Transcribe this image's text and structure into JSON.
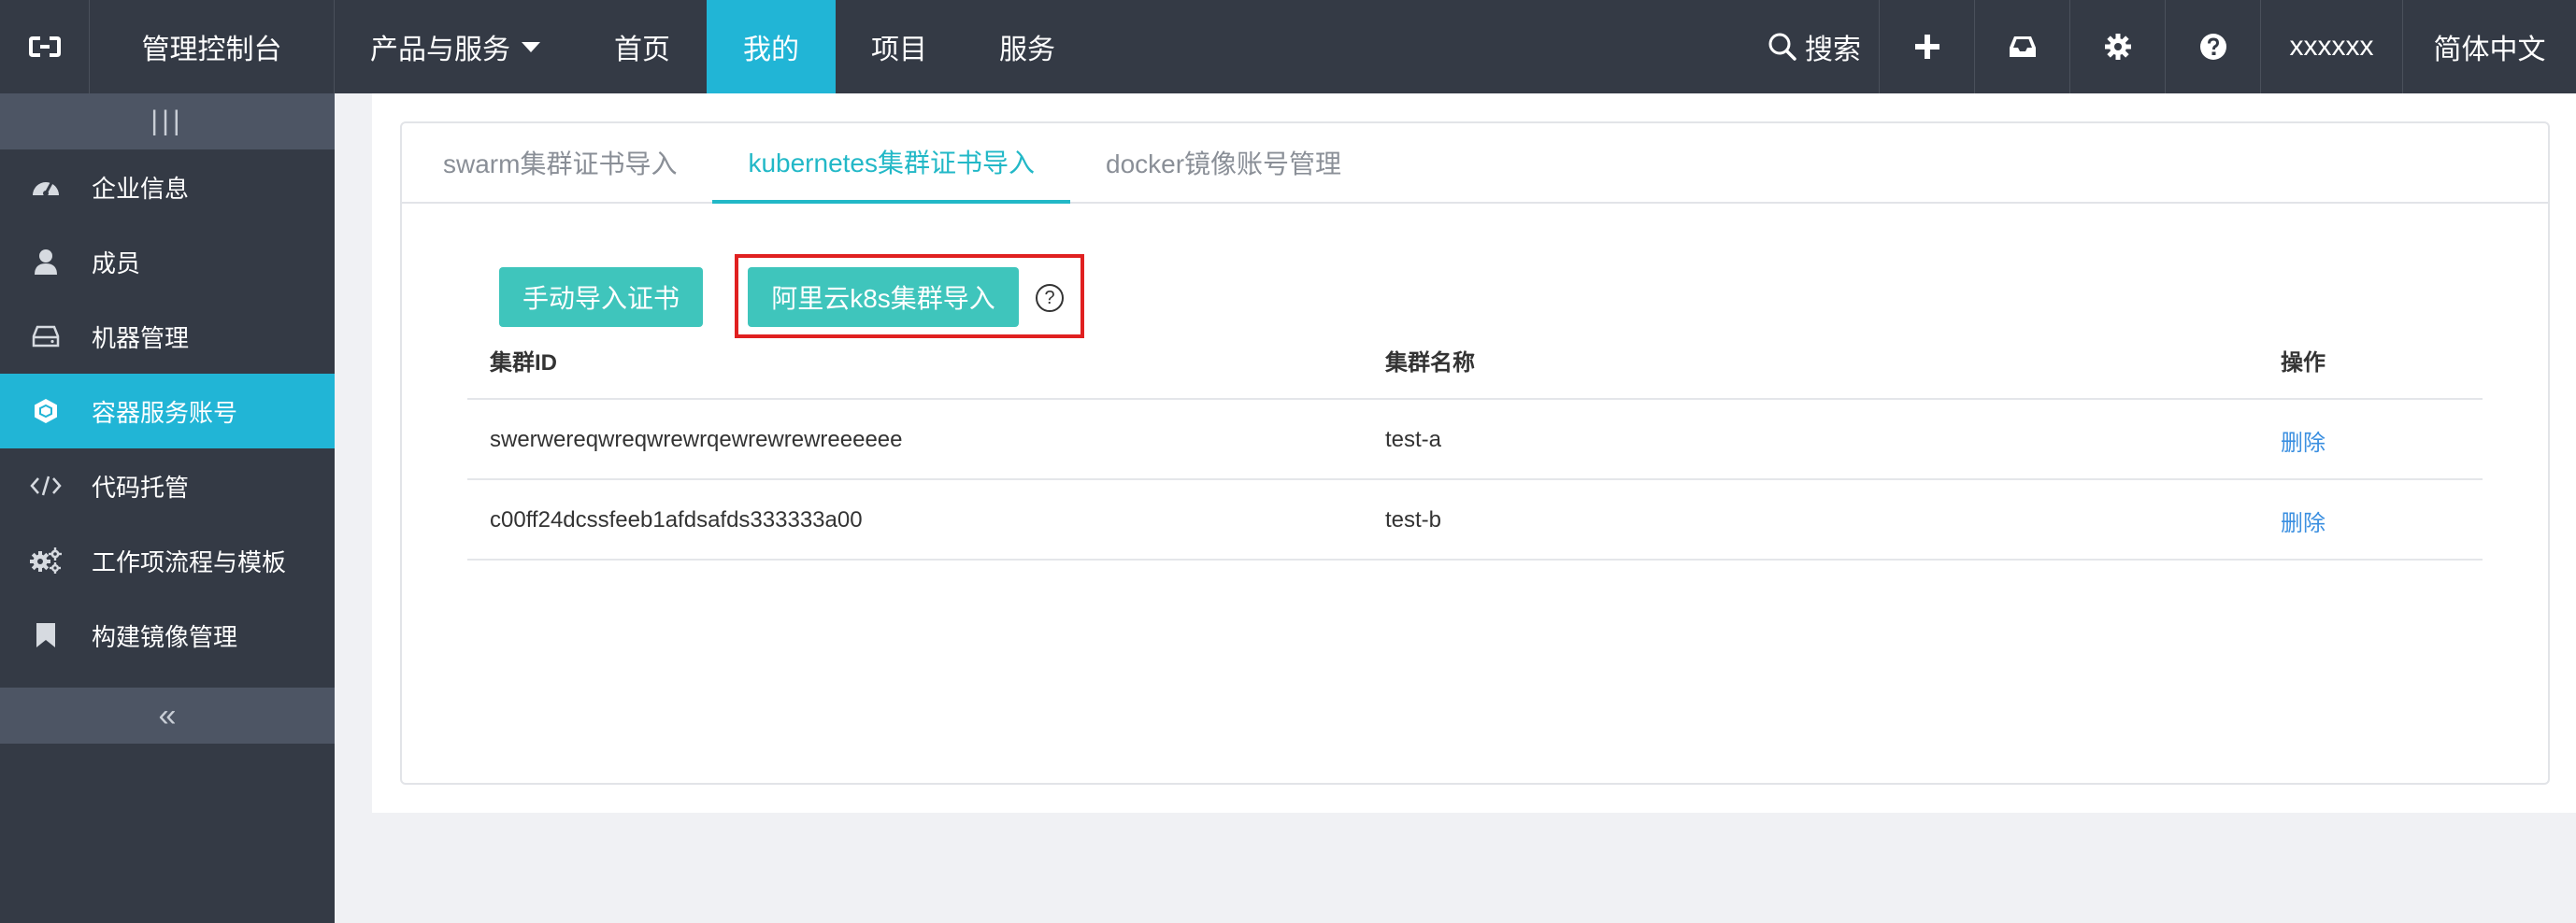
{
  "topbar": {
    "console": "管理控制台",
    "products": "产品与服务",
    "home": "首页",
    "mine": "我的",
    "project": "项目",
    "service": "服务",
    "search": "搜索",
    "user": "xxxxxx",
    "language": "简体中文"
  },
  "sidebar": {
    "toggle_label": "|||",
    "items": [
      {
        "label": "企业信息",
        "icon": "dashboard-icon"
      },
      {
        "label": "成员",
        "icon": "user-icon"
      },
      {
        "label": "机器管理",
        "icon": "drive-icon"
      },
      {
        "label": "容器服务账号",
        "icon": "cube-icon"
      },
      {
        "label": "代码托管",
        "icon": "code-icon"
      },
      {
        "label": "工作项流程与模板",
        "icon": "gears-icon"
      },
      {
        "label": "构建镜像管理",
        "icon": "bookmark-icon"
      }
    ],
    "collapse_label": "«"
  },
  "tabs": [
    {
      "label": "swarm集群证书导入"
    },
    {
      "label": "kubernetes集群证书导入"
    },
    {
      "label": "docker镜像账号管理"
    }
  ],
  "buttons": {
    "manual_import": "手动导入证书",
    "aliyun_import": "阿里云k8s集群导入",
    "help": "?"
  },
  "table": {
    "columns": [
      "集群ID",
      "集群名称",
      "操作"
    ],
    "rows": [
      {
        "id": "swerwereqwreqwrewrqewrewrewreeeeee",
        "name": "test-a",
        "action": "删除"
      },
      {
        "id": "c00ff24dcssfeeb1afdsafds333333a00",
        "name": "test-b",
        "action": "删除"
      }
    ]
  },
  "colors": {
    "topbar_bg": "#343a45",
    "accent": "#21b5d6",
    "button": "#3fc5bc",
    "highlight_border": "#e02020",
    "link": "#3b8fe0"
  }
}
